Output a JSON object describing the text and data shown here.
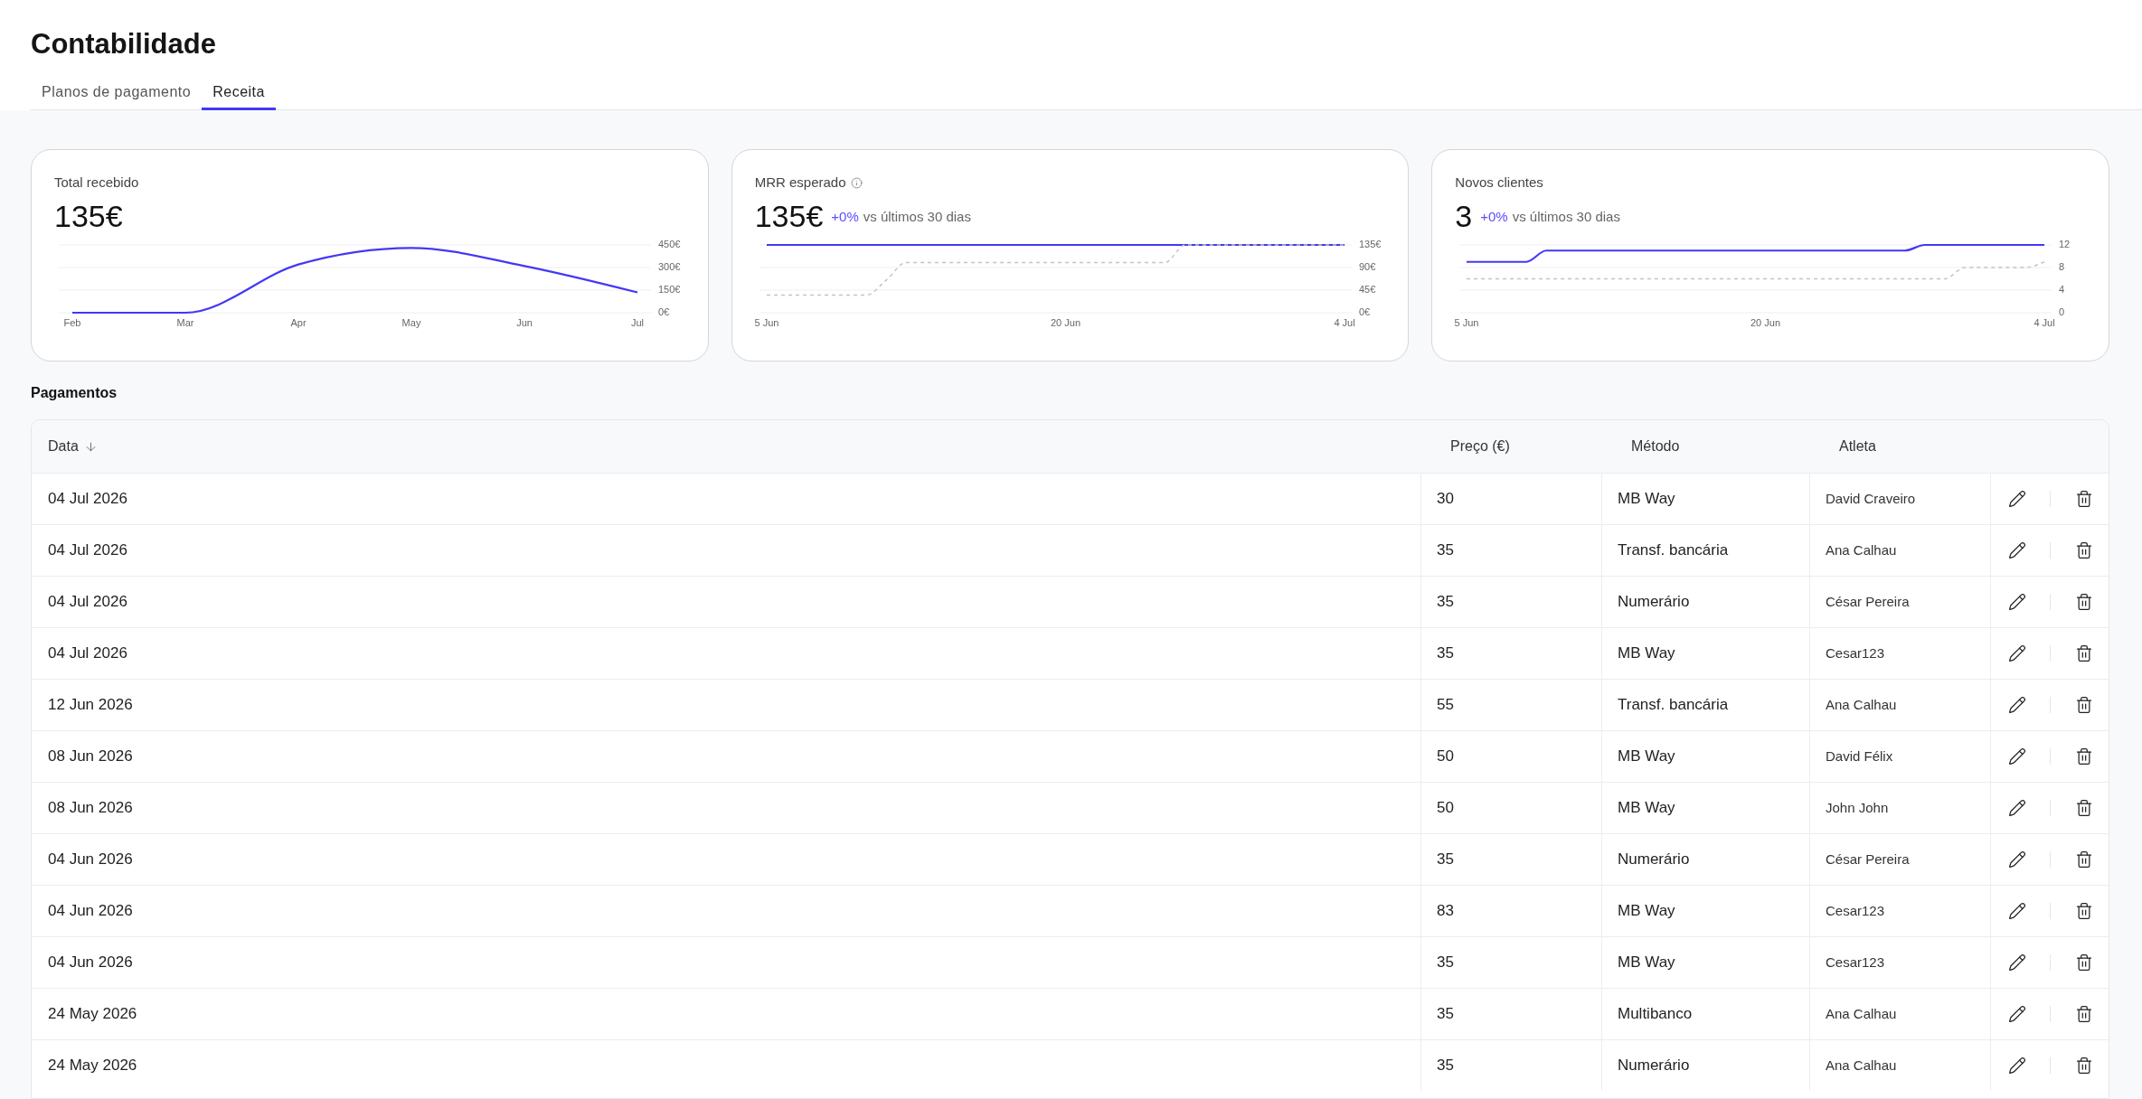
{
  "page": {
    "title": "Contabilidade"
  },
  "tabs": [
    {
      "label": "Planos de pagamento",
      "selected": false
    },
    {
      "label": "Receita",
      "selected": true
    }
  ],
  "cards": [
    {
      "title": "Total recebido",
      "info": false,
      "value": "135€",
      "chart_data": {
        "type": "line",
        "categories": [
          "Feb",
          "Mar",
          "Apr",
          "May",
          "Jun",
          "Jul"
        ],
        "series": [
          {
            "color": "#4338f5",
            "line_style": "solid",
            "values": [
              0,
              0,
              320,
              430,
              310,
              135
            ]
          }
        ],
        "ylim": [
          0,
          450
        ],
        "yticks": [
          {
            "value": 0,
            "label": "0€"
          },
          {
            "value": 150,
            "label": "150€"
          },
          {
            "value": 300,
            "label": "300€"
          },
          {
            "value": 450,
            "label": "450€"
          }
        ]
      }
    },
    {
      "title": "MRR esperado",
      "info": true,
      "value": "135€",
      "change": "+0%",
      "comparison": "vs últimos 30 dias",
      "chart_data": {
        "type": "line",
        "categories": [
          "5 Jun",
          null,
          null,
          null,
          null,
          null,
          null,
          null,
          null,
          null,
          null,
          null,
          null,
          null,
          null,
          "20 Jun",
          null,
          null,
          null,
          null,
          null,
          null,
          null,
          null,
          null,
          null,
          null,
          null,
          null,
          "4 Jul"
        ],
        "series": [
          {
            "color": "#4338f5",
            "line_style": "solid",
            "values": [
              135,
              135,
              135,
              135,
              135,
              135,
              135,
              135,
              135,
              135,
              135,
              135,
              135,
              135,
              135,
              135,
              135,
              135,
              135,
              135,
              135,
              135,
              135,
              135,
              135,
              135,
              135,
              135,
              135,
              135
            ]
          },
          {
            "color": "#c4c4c4",
            "line_style": "dashed",
            "values": [
              35,
              35,
              35,
              35,
              35,
              35,
              65,
              100,
              100,
              100,
              100,
              100,
              100,
              100,
              100,
              100,
              100,
              100,
              100,
              100,
              100,
              135,
              135,
              135,
              135,
              135,
              135,
              135,
              135,
              135
            ]
          }
        ],
        "ylim": [
          0,
          135
        ],
        "yticks": [
          {
            "value": 0,
            "label": "0€"
          },
          {
            "value": 45,
            "label": "45€"
          },
          {
            "value": 90,
            "label": "90€"
          },
          {
            "value": 135,
            "label": "135€"
          }
        ]
      }
    },
    {
      "title": "Novos clientes",
      "info": false,
      "value": "3",
      "change": "+0%",
      "comparison": "vs últimos 30 dias",
      "chart_data": {
        "type": "line",
        "categories": [
          "5 Jun",
          null,
          null,
          null,
          null,
          null,
          null,
          null,
          null,
          null,
          null,
          null,
          null,
          null,
          null,
          "20 Jun",
          null,
          null,
          null,
          null,
          null,
          null,
          null,
          null,
          null,
          null,
          null,
          null,
          null,
          "4 Jul"
        ],
        "series": [
          {
            "color": "#4338f5",
            "line_style": "solid",
            "values": [
              9,
              9,
              9,
              9,
              11,
              11,
              11,
              11,
              11,
              11,
              11,
              11,
              11,
              11,
              11,
              11,
              11,
              11,
              11,
              11,
              11,
              11,
              11,
              12,
              12,
              12,
              12,
              12,
              12,
              12
            ]
          },
          {
            "color": "#c4c4c4",
            "line_style": "dashed",
            "values": [
              6,
              6,
              6,
              6,
              6,
              6,
              6,
              6,
              6,
              6,
              6,
              6,
              6,
              6,
              6,
              6,
              6,
              6,
              6,
              6,
              6,
              6,
              6,
              6,
              6,
              8,
              8,
              8,
              8,
              9
            ]
          }
        ],
        "ylim": [
          0,
          12
        ],
        "yticks": [
          0,
          4,
          8,
          12
        ]
      }
    }
  ],
  "payments": {
    "title": "Pagamentos",
    "columns": [
      {
        "label": "Data",
        "sorted": true
      },
      {
        "label": "Preço (€)",
        "sorted": false
      },
      {
        "label": "Método",
        "sorted": false
      },
      {
        "label": "Atleta",
        "sorted": false
      }
    ],
    "rows": [
      {
        "date": "04 Jul 2026",
        "price": "30",
        "method": "MB Way",
        "athlete": "David Craveiro"
      },
      {
        "date": "04 Jul 2026",
        "price": "35",
        "method": "Transf. bancária",
        "athlete": "Ana Calhau"
      },
      {
        "date": "04 Jul 2026",
        "price": "35",
        "method": "Numerário",
        "athlete": "César Pereira"
      },
      {
        "date": "04 Jul 2026",
        "price": "35",
        "method": "MB Way",
        "athlete": "Cesar123"
      },
      {
        "date": "12 Jun 2026",
        "price": "55",
        "method": "Transf. bancária",
        "athlete": "Ana Calhau"
      },
      {
        "date": "08 Jun 2026",
        "price": "50",
        "method": "MB Way",
        "athlete": "David Félix"
      },
      {
        "date": "08 Jun 2026",
        "price": "50",
        "method": "MB Way",
        "athlete": "John John"
      },
      {
        "date": "04 Jun 2026",
        "price": "35",
        "method": "Numerário",
        "athlete": "César Pereira"
      },
      {
        "date": "04 Jun 2026",
        "price": "83",
        "method": "MB Way",
        "athlete": "Cesar123"
      },
      {
        "date": "04 Jun 2026",
        "price": "35",
        "method": "MB Way",
        "athlete": "Cesar123"
      },
      {
        "date": "24 May 2026",
        "price": "35",
        "method": "Multibanco",
        "athlete": "Ana Calhau"
      },
      {
        "date": "24 May 2026",
        "price": "35",
        "method": "Numerário",
        "athlete": "Ana Calhau"
      }
    ]
  }
}
